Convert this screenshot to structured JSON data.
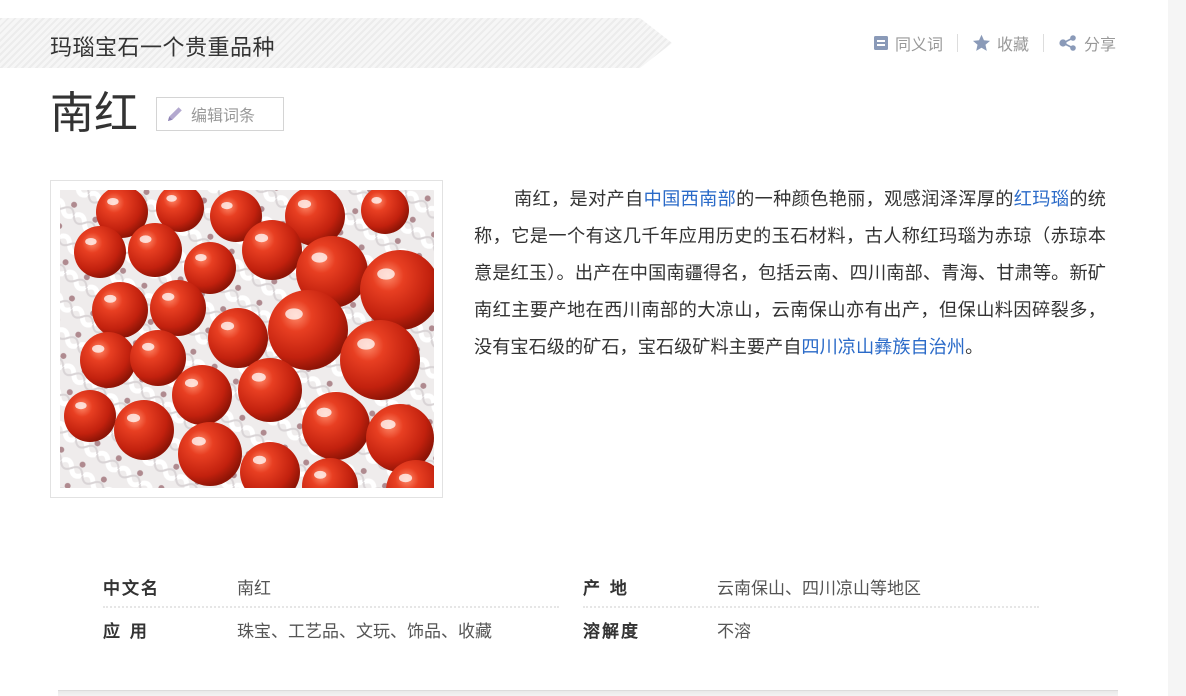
{
  "banner": {
    "title": "玛瑙宝石一个贵重品种"
  },
  "tools": {
    "synonym": {
      "label": "同义词",
      "icon": "synonym-icon"
    },
    "favorite": {
      "label": "收藏",
      "icon": "star-icon"
    },
    "share": {
      "label": "分享",
      "icon": "share-icon"
    }
  },
  "lemma": {
    "title": "南红",
    "edit_label": "编辑词条"
  },
  "summary": {
    "part1": "南红，是对产自",
    "link1": "中国西南部",
    "part2": "的一种颜色艳丽，观感润泽浑厚的",
    "link2": "红玛瑙",
    "part3": "的统称，它是一个有这几千年应用历史的玉石材料，古人称红玛瑙为赤琼（赤琼本意是红玉）。出产在中国南疆得名，包括云南、四川南部、青海、甘肃等。新矿南红主要产地在西川南部的大凉山，云南保山亦有出产，但保山料因碎裂多，没有宝石级的矿石，宝石级矿料主要产自",
    "link3": "四川凉山彝族自治州",
    "part4": "。"
  },
  "basic_info": {
    "rows": [
      [
        {
          "name": "中文名",
          "value": "南红"
        },
        {
          "name": "产 地",
          "value": "云南保山、四川凉山等地区"
        }
      ],
      [
        {
          "name": "应 用",
          "value": "珠宝、工艺品、文玩、饰品、收藏"
        },
        {
          "name": "溶解度",
          "value": "不溶"
        }
      ]
    ]
  },
  "colors": {
    "link": "#2a6ac8",
    "muted": "#999999",
    "bead_red": "#d8301a",
    "cloth": "#ece9ea"
  }
}
